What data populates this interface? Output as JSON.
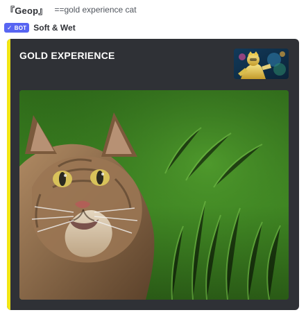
{
  "message": {
    "author": "『Geop』",
    "text": "==gold experience cat"
  },
  "bot": {
    "tag_label": "BOT",
    "name": "Soft & Wet"
  },
  "embed": {
    "title": "GOLD EXPERIENCE",
    "accent_color": "#f2e614",
    "background_color": "#2f3136",
    "thumbnail_icon": "gold-experience-thumbnail",
    "image_icon": "cat-in-grass-photo"
  }
}
